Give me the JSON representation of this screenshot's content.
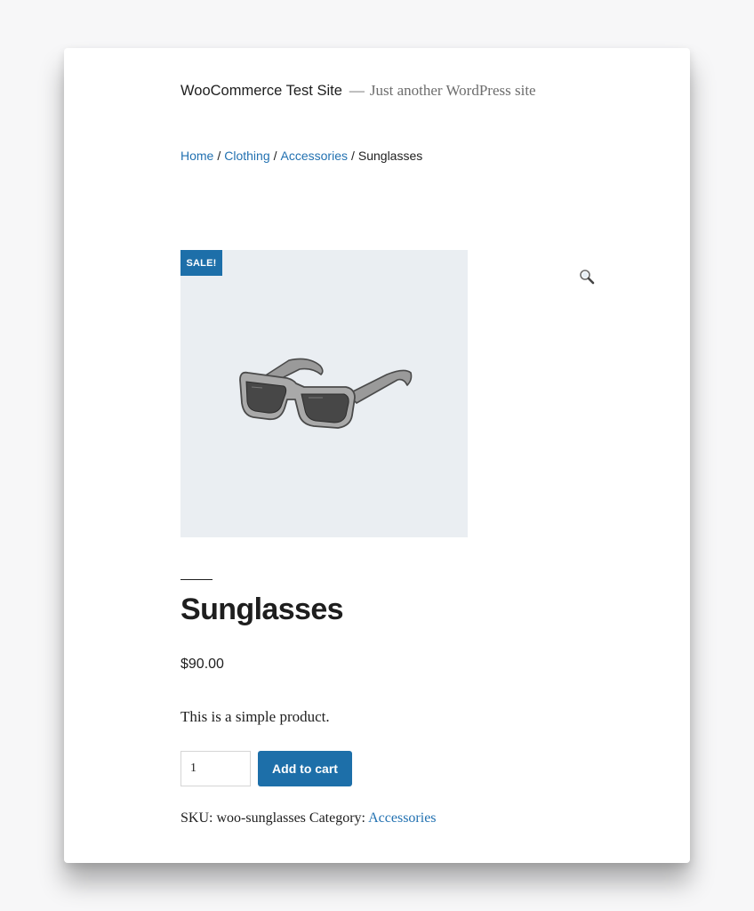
{
  "site": {
    "title": "WooCommerce Test Site",
    "separator": "—",
    "tagline": "Just another WordPress site"
  },
  "breadcrumb": {
    "items": [
      "Home",
      "Clothing",
      "Accessories"
    ],
    "separator": "/",
    "current": "Sunglasses"
  },
  "gallery": {
    "sale_badge": "SALE!",
    "image_icon": "sunglasses-image",
    "zoom_icon": "magnifier-icon"
  },
  "product": {
    "title": "Sunglasses",
    "price": "$90.00",
    "short_description": "This is a simple product.",
    "quantity": "1",
    "add_to_cart_label": "Add to cart"
  },
  "meta": {
    "sku_label": "SKU:",
    "sku_value": "woo-sunglasses",
    "category_label": "Category:",
    "category_value": "Accessories"
  },
  "colors": {
    "accent": "#1d6fa9",
    "link": "#2271b1",
    "text": "#1e1e1e",
    "gallery_bg": "#eaeef2"
  }
}
